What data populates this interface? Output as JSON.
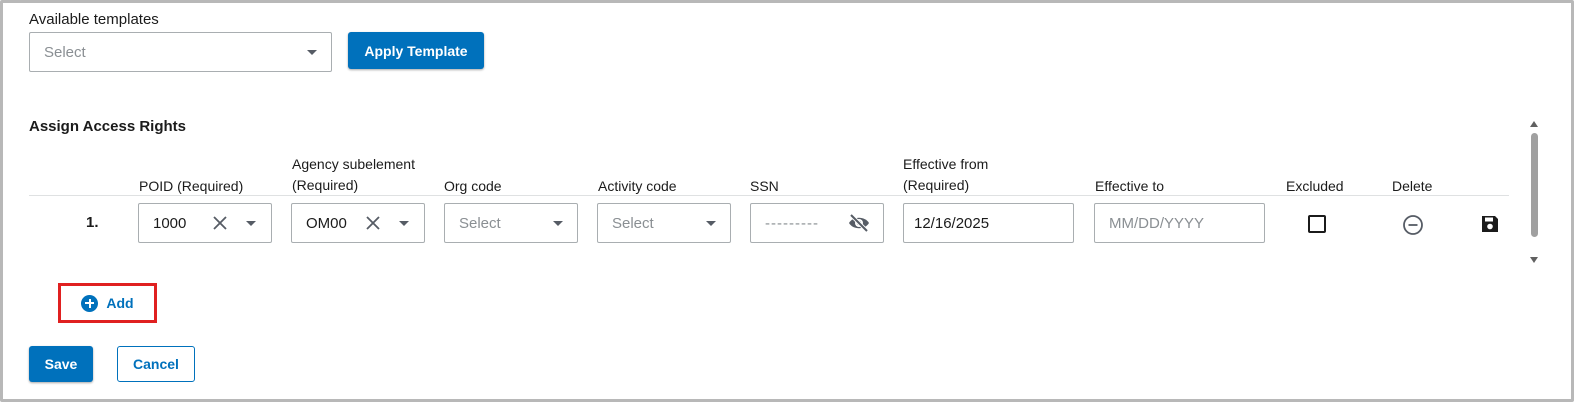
{
  "templates": {
    "label": "Available templates",
    "select_placeholder": "Select",
    "apply_button": "Apply Template"
  },
  "access_rights": {
    "title": "Assign Access Rights",
    "columns": {
      "poid": "POID (Required)",
      "agency_line1": "Agency subelement",
      "agency_line2": "(Required)",
      "org_code": "Org code",
      "activity_code": "Activity code",
      "ssn": "SSN",
      "effective_from_line1": "Effective from",
      "effective_from_line2": "(Required)",
      "effective_to": "Effective to",
      "excluded": "Excluded",
      "delete": "Delete"
    },
    "rows": [
      {
        "number": "1.",
        "poid": "1000",
        "agency": "OM00",
        "org_code_placeholder": "Select",
        "activity_code_placeholder": "Select",
        "ssn_masked": "---------",
        "effective_from": "12/16/2025",
        "effective_to_placeholder": "MM/DD/YYYY",
        "excluded": false
      }
    ],
    "add_button": "Add"
  },
  "footer": {
    "save_button": "Save",
    "cancel_button": "Cancel"
  },
  "icons": {
    "clear": "close-icon",
    "dropdown": "chevron-down-icon",
    "visibility": "eye-off-icon",
    "delete": "minus-circle-icon",
    "save": "floppy-disk-icon",
    "add": "plus-circle-icon"
  },
  "colors": {
    "primary": "#0071bc",
    "highlight": "#e02020"
  }
}
